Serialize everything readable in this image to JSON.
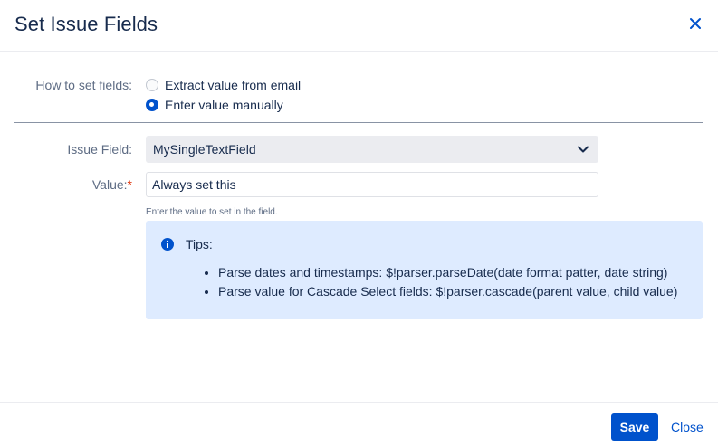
{
  "dialog": {
    "title": "Set Issue Fields",
    "close_icon": "close-icon"
  },
  "how_to_set": {
    "label": "How to set fields:",
    "options": [
      {
        "label": "Extract value from email",
        "checked": false
      },
      {
        "label": "Enter value manually",
        "checked": true
      }
    ]
  },
  "issue_field": {
    "label": "Issue Field:",
    "selected": "MySingleTextField"
  },
  "value_field": {
    "label": "Value:",
    "required_marker": "*",
    "value": "Always set this",
    "help": "Enter the value to set in the field."
  },
  "tips": {
    "icon": "info-icon",
    "title": "Tips:",
    "items": [
      "Parse dates and timestamps: $!parser.parseDate(date format patter, date string)",
      "Parse value for Cascade Select fields: $!parser.cascade(parent value, child value)"
    ]
  },
  "footer": {
    "save_label": "Save",
    "close_label": "Close"
  },
  "colors": {
    "primary": "#0052cc",
    "tips_background": "#deebff",
    "select_background": "#ebecf0"
  }
}
